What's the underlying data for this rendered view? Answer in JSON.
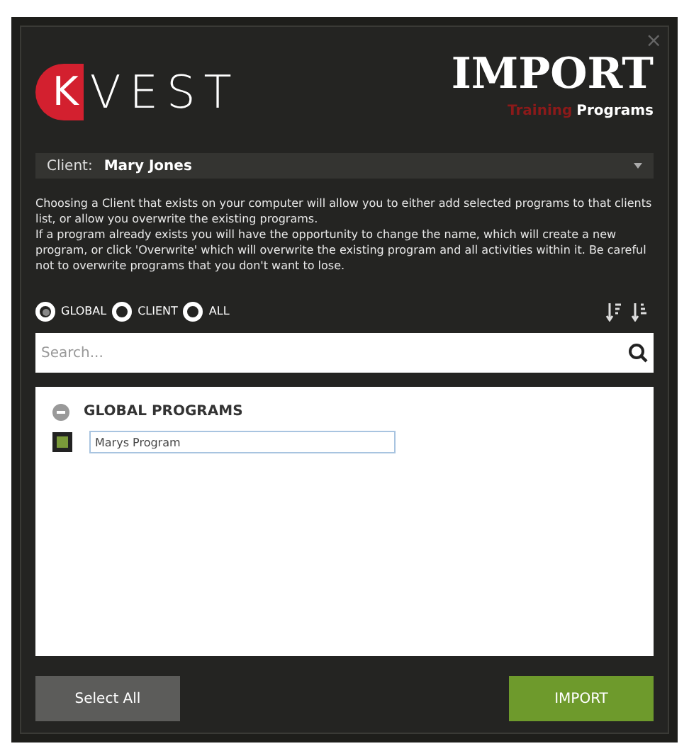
{
  "logo": {
    "letter": "K",
    "word": "VEST"
  },
  "header": {
    "title": "IMPORT",
    "subtitle_accent": "Training",
    "subtitle": "Programs"
  },
  "close": "×",
  "client": {
    "label": "Client:",
    "value": "Mary Jones"
  },
  "description": [
    "Choosing a Client that exists on your computer will allow you to either add selected programs to that clients list, or allow you overwrite the existing programs.",
    "If a program already exists you will have the opportunity to change the name, which will create a new program, or click 'Overwrite' which will overwrite the existing program and all activities within it. Be careful not to overwrite programs that you don't want to lose."
  ],
  "filters": [
    {
      "label": "GLOBAL",
      "selected": true
    },
    {
      "label": "CLIENT",
      "selected": false
    },
    {
      "label": "ALL",
      "selected": false
    }
  ],
  "search": {
    "placeholder": "Search..."
  },
  "groups": [
    {
      "title": "GLOBAL PROGRAMS",
      "expanded": true,
      "programs": [
        {
          "name": "Marys Program",
          "checked": true
        }
      ]
    }
  ],
  "buttons": [
    {
      "label": "Select All",
      "kind": "secondary"
    },
    {
      "label": "IMPORT",
      "kind": "primary"
    }
  ]
}
